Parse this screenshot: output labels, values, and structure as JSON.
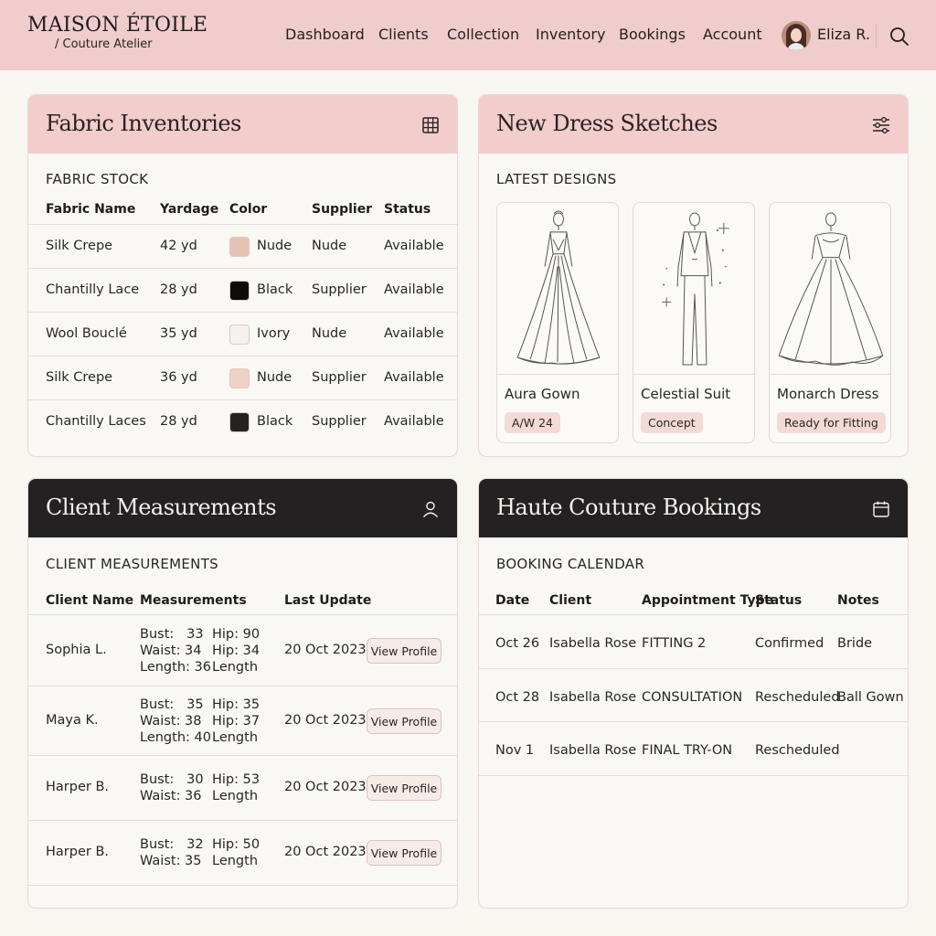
{
  "brand": {
    "name": "MAISON ÉTOILE",
    "subtitle": "/ Couture Atelier"
  },
  "nav": [
    "Dashboard",
    "Clients",
    "Collection",
    "Inventory",
    "Bookings",
    "Account"
  ],
  "user": {
    "name": "Eliza R."
  },
  "fabric": {
    "title": "Fabric Inventories",
    "section": "FABRIC STOCK",
    "headers": [
      "Fabric Name",
      "Yardage",
      "Color",
      "Supplier",
      "Status"
    ],
    "rows": [
      {
        "name": "Silk Crepe",
        "yardage": "42 yd",
        "color": "Nude",
        "swatch": "#e8c2b2",
        "supplier": "Nude",
        "status": "Available"
      },
      {
        "name": "Chantilly Lace",
        "yardage": "28 yd",
        "color": "Black",
        "swatch": "#0d0b0b",
        "supplier": "Supplier",
        "status": "Available"
      },
      {
        "name": "Wool Bouclé",
        "yardage": "35 yd",
        "color": "Ivory",
        "swatch": "#f6f1ea",
        "supplier": "Nude",
        "status": "Available"
      },
      {
        "name": "Silk Crepe",
        "yardage": "36 yd",
        "color": "Nude",
        "swatch": "#efd2c6",
        "supplier": "Supplier",
        "status": "Available"
      },
      {
        "name": "Chantilly Laces",
        "yardage": "28 yd",
        "color": "Black",
        "swatch": "#252222",
        "supplier": "Supplier",
        "status": "Available"
      }
    ]
  },
  "sketches": {
    "title": "New Dress Sketches",
    "section": "LATEST DESIGNS",
    "items": [
      {
        "name": "Aura Gown",
        "tag": "A/W 24"
      },
      {
        "name": "Celestial Suit",
        "tag": "Concept"
      },
      {
        "name": "Monarch Dress",
        "tag": "Ready for Fitting"
      }
    ]
  },
  "measurements": {
    "title": "Client Measurements",
    "section": "CLIENT MEASUREMENTS",
    "headers": [
      "Client Name",
      "Measurements",
      "Last Update"
    ],
    "button_label": "View Profile",
    "rows": [
      {
        "client": "Sophia L.",
        "left": "Bust:   33\nWaist: 34\nLength: 36",
        "right": "Hip: 90\nHip: 34\nLength",
        "date": "20 Oct 2023"
      },
      {
        "client": "Maya K.",
        "left": "Bust:   35\nWaist: 38\nLength: 40",
        "right": "Hip: 35\nHip: 37\nLength",
        "date": "20 Oct 2023"
      },
      {
        "client": "Harper B.",
        "left": "Bust:   30\nWaist: 36",
        "right": "Hip: 53\nLength",
        "date": "20 Oct 2023"
      },
      {
        "client": "Harper B.",
        "left": "Bust:   32\nWaist: 35",
        "right": "Hip: 50\nLength",
        "date": "20 Oct 2023"
      }
    ]
  },
  "bookings": {
    "title": "Haute Couture Bookings",
    "section": "BOOKING CALENDAR",
    "headers": [
      "Date",
      "Client",
      "Appointment Type",
      "Status",
      "Notes"
    ],
    "rows": [
      {
        "date": "Oct 26",
        "client": "Isabella Rose",
        "type": "FITTING 2",
        "status": "Confirmed",
        "notes": "Bride"
      },
      {
        "date": "Oct 28",
        "client": "Isabella Rose",
        "type": "CONSULTATION",
        "status": "Rescheduled",
        "notes": "Ball Gown"
      },
      {
        "date": "Nov 1",
        "client": "Isabella Rose",
        "type": "FINAL TRY-ON",
        "status": "Rescheduled",
        "notes": ""
      }
    ]
  }
}
